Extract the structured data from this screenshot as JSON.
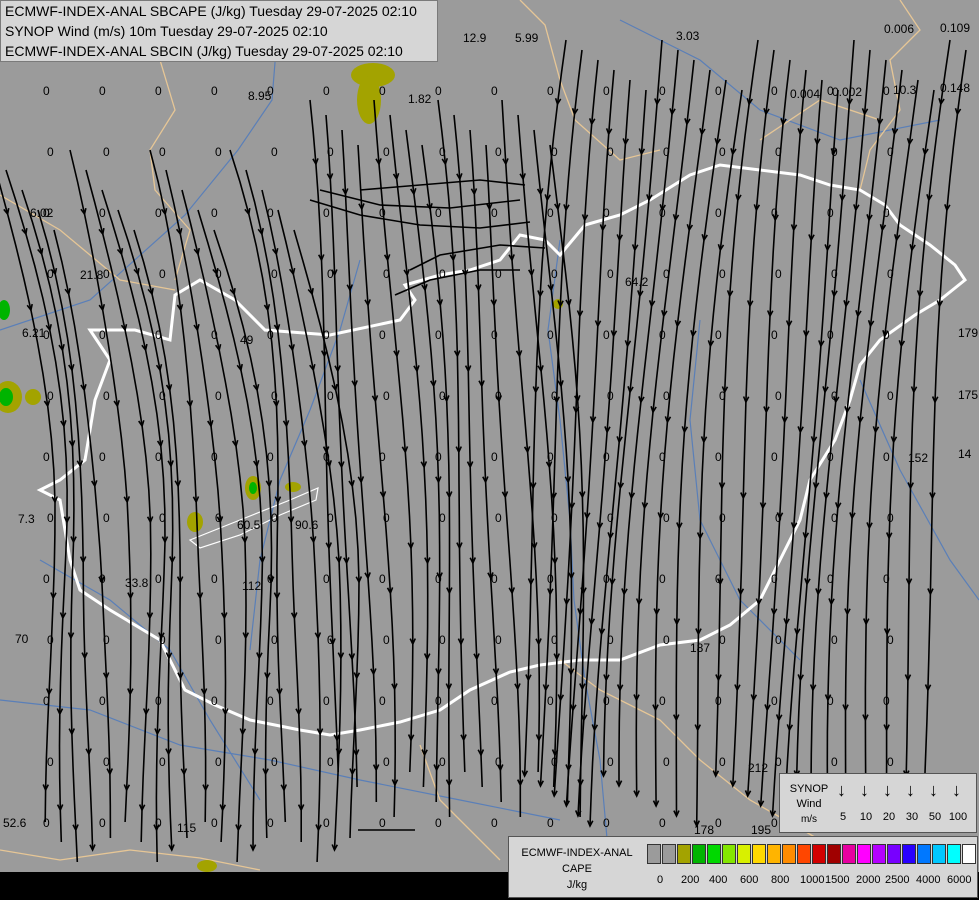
{
  "header": {
    "line1": "ECMWF-INDEX-ANAL SBCAPE (J/kg) Tuesday 29-07-2025 02:10",
    "line2": "SYNOP Wind (m/s) 10m Tuesday 29-07-2025 02:10",
    "line3": "ECMWF-INDEX-ANAL SBCIN (J/kg) Tuesday 29-07-2025 02:10"
  },
  "colors": {
    "land": "#9b9b9b",
    "border_hungary": "#ffffff",
    "border_countries": "#e6c696",
    "rivers": "#5a7fb8",
    "streamlines": "#000000",
    "cape_low": "#a3a300",
    "cape_mid": "#00b400"
  },
  "map_values": [
    {
      "t": "0",
      "id": "v1"
    },
    {
      "t": "12.9",
      "id": "v2"
    },
    {
      "t": "5.99",
      "id": "v3"
    },
    {
      "t": "3.03",
      "id": "v4"
    },
    {
      "t": "0.006",
      "id": "v5"
    },
    {
      "t": "0.109",
      "id": "v6"
    },
    {
      "t": "8.95",
      "id": "v7"
    },
    {
      "t": "1.82",
      "id": "v8"
    },
    {
      "t": "0.004",
      "id": "v9"
    },
    {
      "t": "0.002",
      "id": "v10"
    },
    {
      "t": "10.3",
      "id": "v11"
    },
    {
      "t": "0.148",
      "id": "v12"
    },
    {
      "t": "6.02",
      "id": "v13"
    },
    {
      "t": "21.8",
      "id": "v14"
    },
    {
      "t": "64.2",
      "id": "v15"
    },
    {
      "t": "6.21",
      "id": "v16"
    },
    {
      "t": "49",
      "id": "v17"
    },
    {
      "t": "179",
      "id": "v18"
    },
    {
      "t": "175",
      "id": "v19"
    },
    {
      "t": "152",
      "id": "v20"
    },
    {
      "t": "14",
      "id": "v21"
    },
    {
      "t": "7.3",
      "id": "v22"
    },
    {
      "t": "60.5",
      "id": "v23"
    },
    {
      "t": "90.6",
      "id": "v24"
    },
    {
      "t": "33.8",
      "id": "v25"
    },
    {
      "t": "112",
      "id": "v26"
    },
    {
      "t": "70",
      "id": "v27"
    },
    {
      "t": "187",
      "id": "v28"
    },
    {
      "t": "212",
      "id": "v29"
    },
    {
      "t": "52.6",
      "id": "v30"
    },
    {
      "t": "115",
      "id": "v31"
    },
    {
      "t": "178",
      "id": "v32"
    },
    {
      "t": "195",
      "id": "v33"
    }
  ],
  "synop_legend": {
    "title_line1": "SYNOP",
    "title_line2": "Wind",
    "title_line3": "m/s",
    "arrow_glyph": "↓",
    "speeds": [
      "5",
      "10",
      "20",
      "30",
      "50",
      "100"
    ]
  },
  "cape_legend": {
    "title_line1": "ECMWF-INDEX-ANAL",
    "title_line2": "CAPE",
    "title_line3": "J/kg",
    "swatches": [
      "#9b9b9b",
      "#9b9b9b",
      "#a3a300",
      "#00b400",
      "#00d800",
      "#84e600",
      "#d8f000",
      "#ffd800",
      "#ffb400",
      "#ff8c00",
      "#ff4600",
      "#d20000",
      "#a00000",
      "#e600a0",
      "#ff00ff",
      "#b400ff",
      "#7800ff",
      "#2800ff",
      "#0078ff",
      "#00c8ff",
      "#00ffff",
      "#ffffff"
    ],
    "labels": [
      "0",
      "200",
      "400",
      "600",
      "800",
      "1000",
      "1500",
      "2000",
      "2500",
      "4000",
      "6000"
    ]
  }
}
